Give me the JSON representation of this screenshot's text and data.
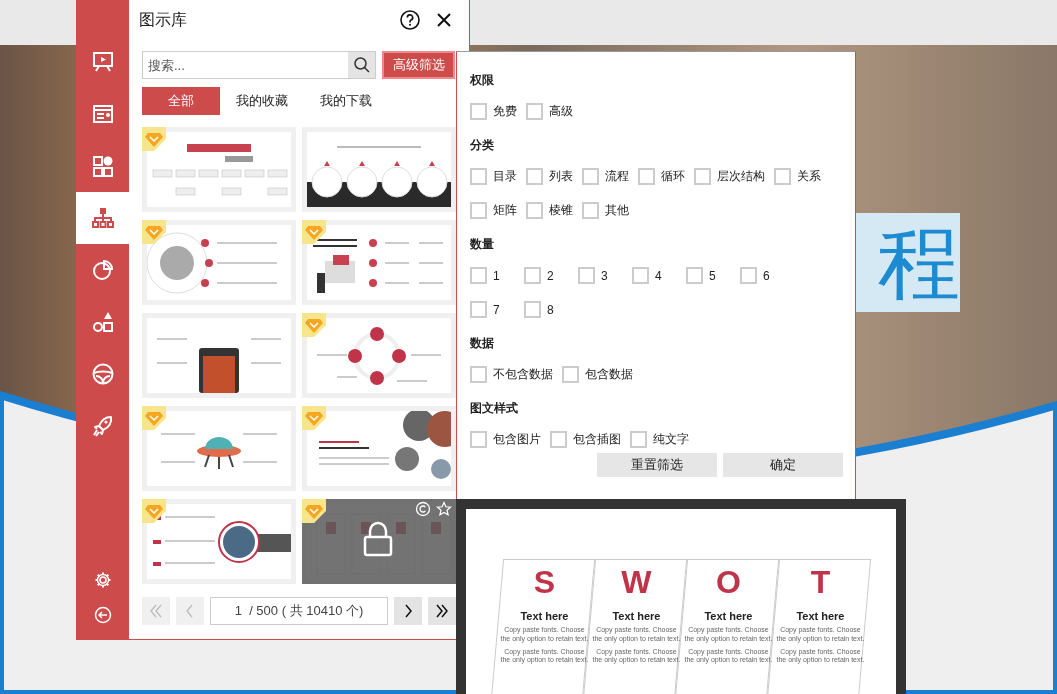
{
  "background": {
    "slide_text": "程"
  },
  "sidebar": {
    "items": [
      {
        "selected": false
      },
      {
        "selected": false
      },
      {
        "selected": false
      },
      {
        "selected": true
      },
      {
        "selected": false
      },
      {
        "selected": false
      },
      {
        "selected": false
      },
      {
        "selected": false
      }
    ]
  },
  "panel": {
    "title": "图示库",
    "search": {
      "placeholder": "搜索..."
    },
    "filter_button": "高级筛选",
    "tabs": [
      {
        "label": "全部",
        "selected": true
      },
      {
        "label": "我的收藏",
        "selected": false
      },
      {
        "label": "我的下载",
        "selected": false
      }
    ],
    "thumbnails": [
      {
        "kind": "org-chart",
        "premium": true,
        "locked": false
      },
      {
        "kind": "steps",
        "premium": false,
        "locked": false
      },
      {
        "kind": "globe",
        "premium": true,
        "locked": false
      },
      {
        "kind": "laptop",
        "premium": true,
        "locked": false
      },
      {
        "kind": "phone",
        "premium": false,
        "locked": false
      },
      {
        "kind": "swot-circle",
        "premium": true,
        "locked": false
      },
      {
        "kind": "ufo",
        "premium": true,
        "locked": false
      },
      {
        "kind": "photos",
        "premium": true,
        "locked": false
      },
      {
        "kind": "list",
        "premium": true,
        "locked": false
      },
      {
        "kind": "swot-cards",
        "premium": true,
        "locked": true
      }
    ],
    "pagination": {
      "page": "1  / 500 ( 共 10410 个)"
    }
  },
  "filter": {
    "sections": [
      {
        "title": "权限",
        "options": [
          {
            "label": "免费",
            "checked": false
          },
          {
            "label": "高级",
            "checked": false
          }
        ]
      },
      {
        "title": "分类",
        "options": [
          {
            "label": "目录",
            "checked": false
          },
          {
            "label": "列表",
            "checked": false
          },
          {
            "label": "流程",
            "checked": false
          },
          {
            "label": "循环",
            "checked": false
          },
          {
            "label": "层次结构",
            "checked": false
          },
          {
            "label": "关系",
            "checked": false
          },
          {
            "label": "矩阵",
            "checked": false
          },
          {
            "label": "棱锥",
            "checked": false
          },
          {
            "label": "其他",
            "checked": false
          }
        ]
      },
      {
        "title": "数量",
        "options": [
          {
            "label": "1",
            "checked": false
          },
          {
            "label": "2",
            "checked": false
          },
          {
            "label": "3",
            "checked": false
          },
          {
            "label": "4",
            "checked": false
          },
          {
            "label": "5",
            "checked": false
          },
          {
            "label": "6",
            "checked": false
          },
          {
            "label": "7",
            "checked": false
          },
          {
            "label": "8",
            "checked": false
          }
        ]
      },
      {
        "title": "数据",
        "options": [
          {
            "label": "不包含数据",
            "checked": false
          },
          {
            "label": "包含数据",
            "checked": false
          }
        ]
      },
      {
        "title": "图文样式",
        "options": [
          {
            "label": "包含图片",
            "checked": false
          },
          {
            "label": "包含插图",
            "checked": false
          },
          {
            "label": "纯文字",
            "checked": false
          }
        ]
      }
    ],
    "buttons": [
      "重置筛选",
      "确定"
    ]
  },
  "preview": {
    "cards": [
      {
        "letter": "S",
        "heading": "Text here",
        "lines": [
          "Copy paste fonts. Choose the only option to retain text.",
          "Copy paste fonts. Choose the only option to retain text."
        ]
      },
      {
        "letter": "W",
        "heading": "Text here",
        "lines": [
          "Copy paste fonts. Choose the only option to retain text.",
          "Copy paste fonts. Choose the only option to retain text."
        ]
      },
      {
        "letter": "O",
        "heading": "Text here",
        "lines": [
          "Copy paste fonts. Choose the only option to retain text.",
          "Copy paste fonts. Choose the only option to retain text."
        ]
      },
      {
        "letter": "T",
        "heading": "Text here",
        "lines": [
          "Copy paste fonts. Choose the only option to retain text.",
          "Copy paste fonts. Choose the only option to retain text."
        ]
      }
    ]
  }
}
